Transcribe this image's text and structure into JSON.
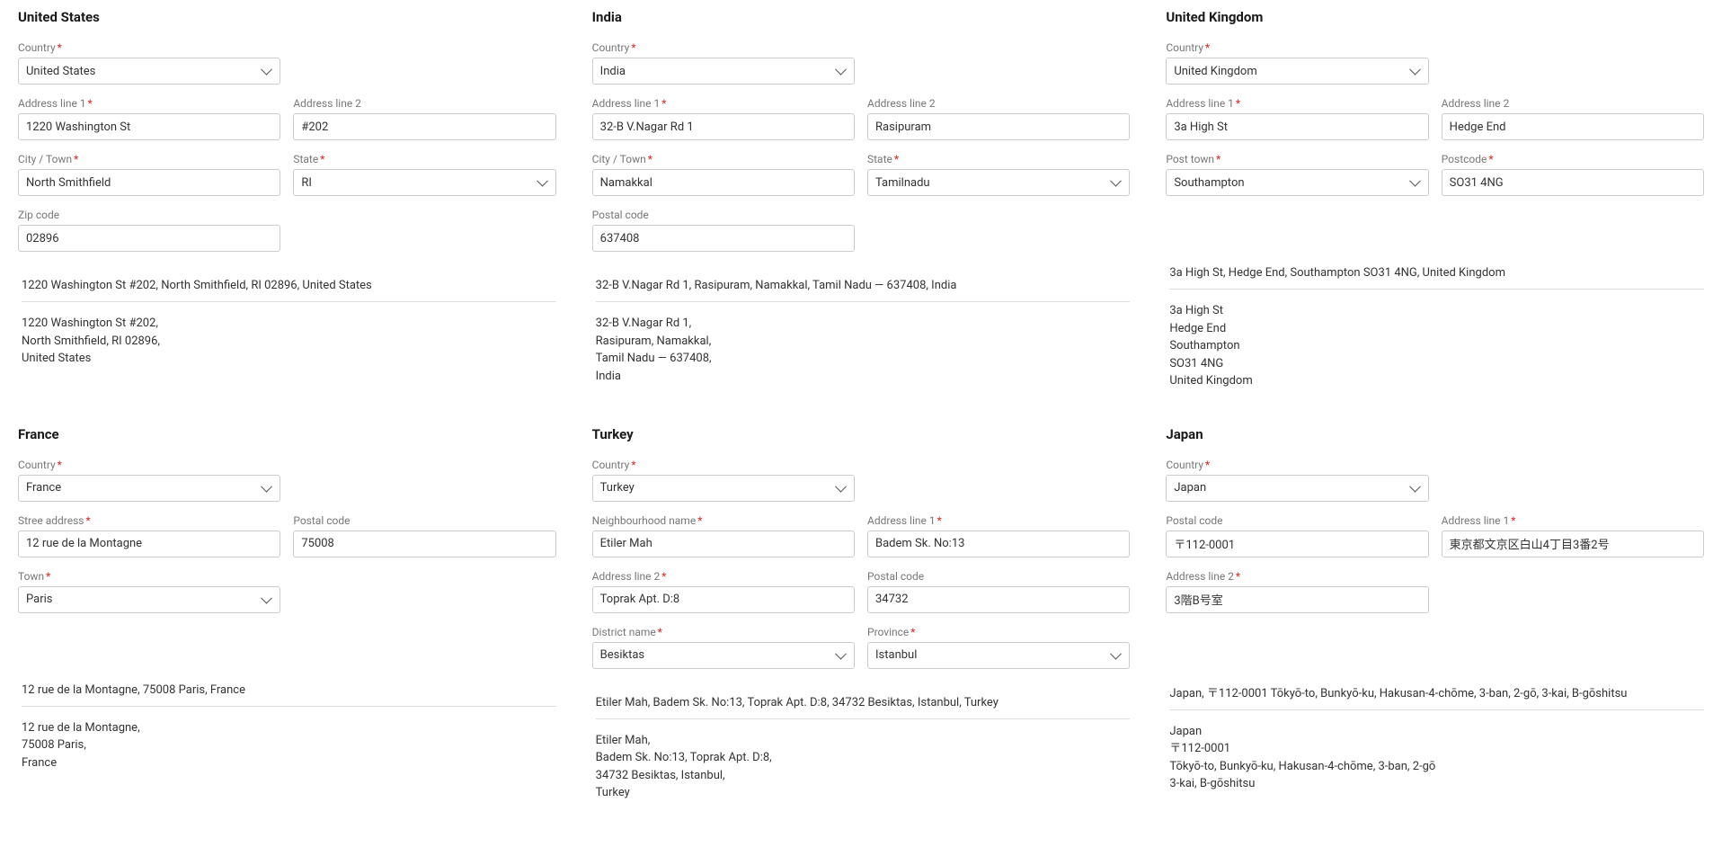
{
  "sections": {
    "us": {
      "title": "United States",
      "country_label": "Country",
      "country_value": "United States",
      "addr1_label": "Address line 1",
      "addr1_value": "1220 Washington St",
      "addr2_label": "Address line 2",
      "addr2_value": "#202",
      "city_label": "City / Town",
      "city_value": "North Smithfield",
      "state_label": "State",
      "state_value": "RI",
      "zip_label": "Zip code",
      "zip_value": "02896",
      "summary_single": "1220 Washington St #202, North Smithfield, RI 02896, United States",
      "summary_multi": "1220 Washington St #202,\nNorth Smithfield, RI 02896,\nUnited States"
    },
    "in": {
      "title": "India",
      "country_label": "Country",
      "country_value": "India",
      "addr1_label": "Address line 1",
      "addr1_value": "32-B V.Nagar Rd 1",
      "addr2_label": "Address line 2",
      "addr2_value": "Rasipuram",
      "city_label": "City / Town",
      "city_value": "Namakkal",
      "state_label": "State",
      "state_value": "Tamilnadu",
      "postal_label": "Postal code",
      "postal_value": "637408",
      "summary_single": "32-B V.Nagar Rd 1, Rasipuram, Namakkal, Tamil Nadu — 637408, India",
      "summary_multi": "32-B V.Nagar Rd 1,\nRasipuram, Namakkal,\nTamil Nadu — 637408,\nIndia"
    },
    "uk": {
      "title": "United Kingdom",
      "country_label": "Country",
      "country_value": "United Kingdom",
      "addr1_label": "Address line 1",
      "addr1_value": "3a High St",
      "addr2_label": "Address line 2",
      "addr2_value": "Hedge End",
      "posttown_label": "Post town",
      "posttown_value": "Southampton",
      "postcode_label": "Postcode",
      "postcode_value": "SO31 4NG",
      "summary_single": "3a High St, Hedge End, Southampton SO31 4NG, United Kingdom",
      "summary_multi": "3a High St\nHedge End\nSouthampton\nSO31 4NG\nUnited Kingdom"
    },
    "fr": {
      "title": "France",
      "country_label": "Country",
      "country_value": "France",
      "street_label": "Stree address",
      "street_value": "12 rue de la Montagne",
      "postal_label": "Postal code",
      "postal_value": "75008",
      "town_label": "Town",
      "town_value": "Paris",
      "summary_single": "12 rue de la Montagne, 75008 Paris, France",
      "summary_multi": "12 rue de la Montagne,\n75008 Paris,\nFrance"
    },
    "tr": {
      "title": "Turkey",
      "country_label": "Country",
      "country_value": "Turkey",
      "neighbourhood_label": "Neighbourhood name",
      "neighbourhood_value": "Etiler Mah",
      "addr1_label": "Address line 1",
      "addr1_value": "Badem Sk. No:13",
      "addr2_label": "Address line 2",
      "addr2_value": "Toprak Apt. D:8",
      "postal_label": "Postal code",
      "postal_value": "34732",
      "district_label": "District name",
      "district_value": "Besiktas",
      "province_label": "Province",
      "province_value": "Istanbul",
      "summary_single": "Etiler Mah, Badem Sk. No:13, Toprak Apt. D:8, 34732 Besiktas, Istanbul, Turkey",
      "summary_multi": "Etiler Mah,\nBadem Sk. No:13, Toprak Apt. D:8,\n34732 Besiktas, Istanbul,\nTurkey"
    },
    "jp": {
      "title": "Japan",
      "country_label": "Country",
      "country_value": "Japan",
      "postal_label": "Postal code",
      "postal_value": "〒112-0001",
      "addr1_label": "Address line 1",
      "addr1_value": "東京都文京区白山4丁目3番2号",
      "addr2_label": "Address line 2",
      "addr2_value": "3階B号室",
      "summary_single": "Japan, 〒112-0001 Tōkyō-to, Bunkyō-ku, Hakusan-4-chōme, 3-ban, 2-gō, 3-kai, B-gōshitsu",
      "summary_multi": "Japan\n〒112-0001\nTōkyō-to, Bunkyō-ku, Hakusan-4-chōme, 3-ban, 2-gō\n3-kai, B-gōshitsu"
    }
  }
}
